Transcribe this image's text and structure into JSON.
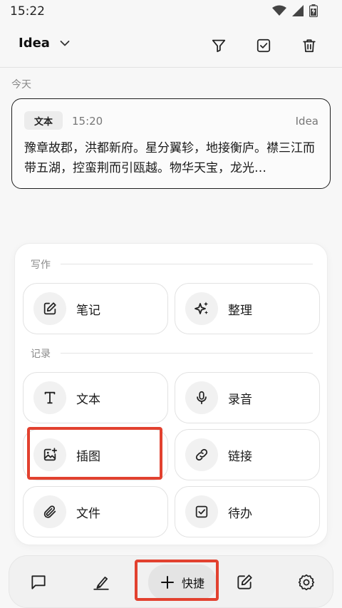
{
  "status": {
    "time": "15:22"
  },
  "header": {
    "title": "Idea"
  },
  "list": {
    "section_date": "今天",
    "notes": [
      {
        "badge": "文本",
        "time": "15:20",
        "tag": "Idea",
        "body": "豫章故郡，洪都新府。星分翼轸，地接衡庐。襟三江而带五湖，控蛮荆而引瓯越。物华天宝，龙光…"
      }
    ]
  },
  "quick_panel": {
    "sections": [
      {
        "label": "写作",
        "items": [
          {
            "label": "笔记",
            "icon": "note-edit-icon"
          },
          {
            "label": "整理",
            "icon": "sparkle-icon"
          }
        ]
      },
      {
        "label": "记录",
        "items": [
          {
            "label": "文本",
            "icon": "text-icon"
          },
          {
            "label": "录音",
            "icon": "microphone-icon"
          },
          {
            "label": "插图",
            "icon": "image-add-icon"
          },
          {
            "label": "链接",
            "icon": "link-icon"
          },
          {
            "label": "文件",
            "icon": "paperclip-icon"
          },
          {
            "label": "待办",
            "icon": "checkbox-icon"
          }
        ]
      }
    ]
  },
  "bottom_bar": {
    "quick_label": "快捷"
  },
  "colors": {
    "highlight": "#e2412f",
    "card_border": "#1f1f1f"
  }
}
